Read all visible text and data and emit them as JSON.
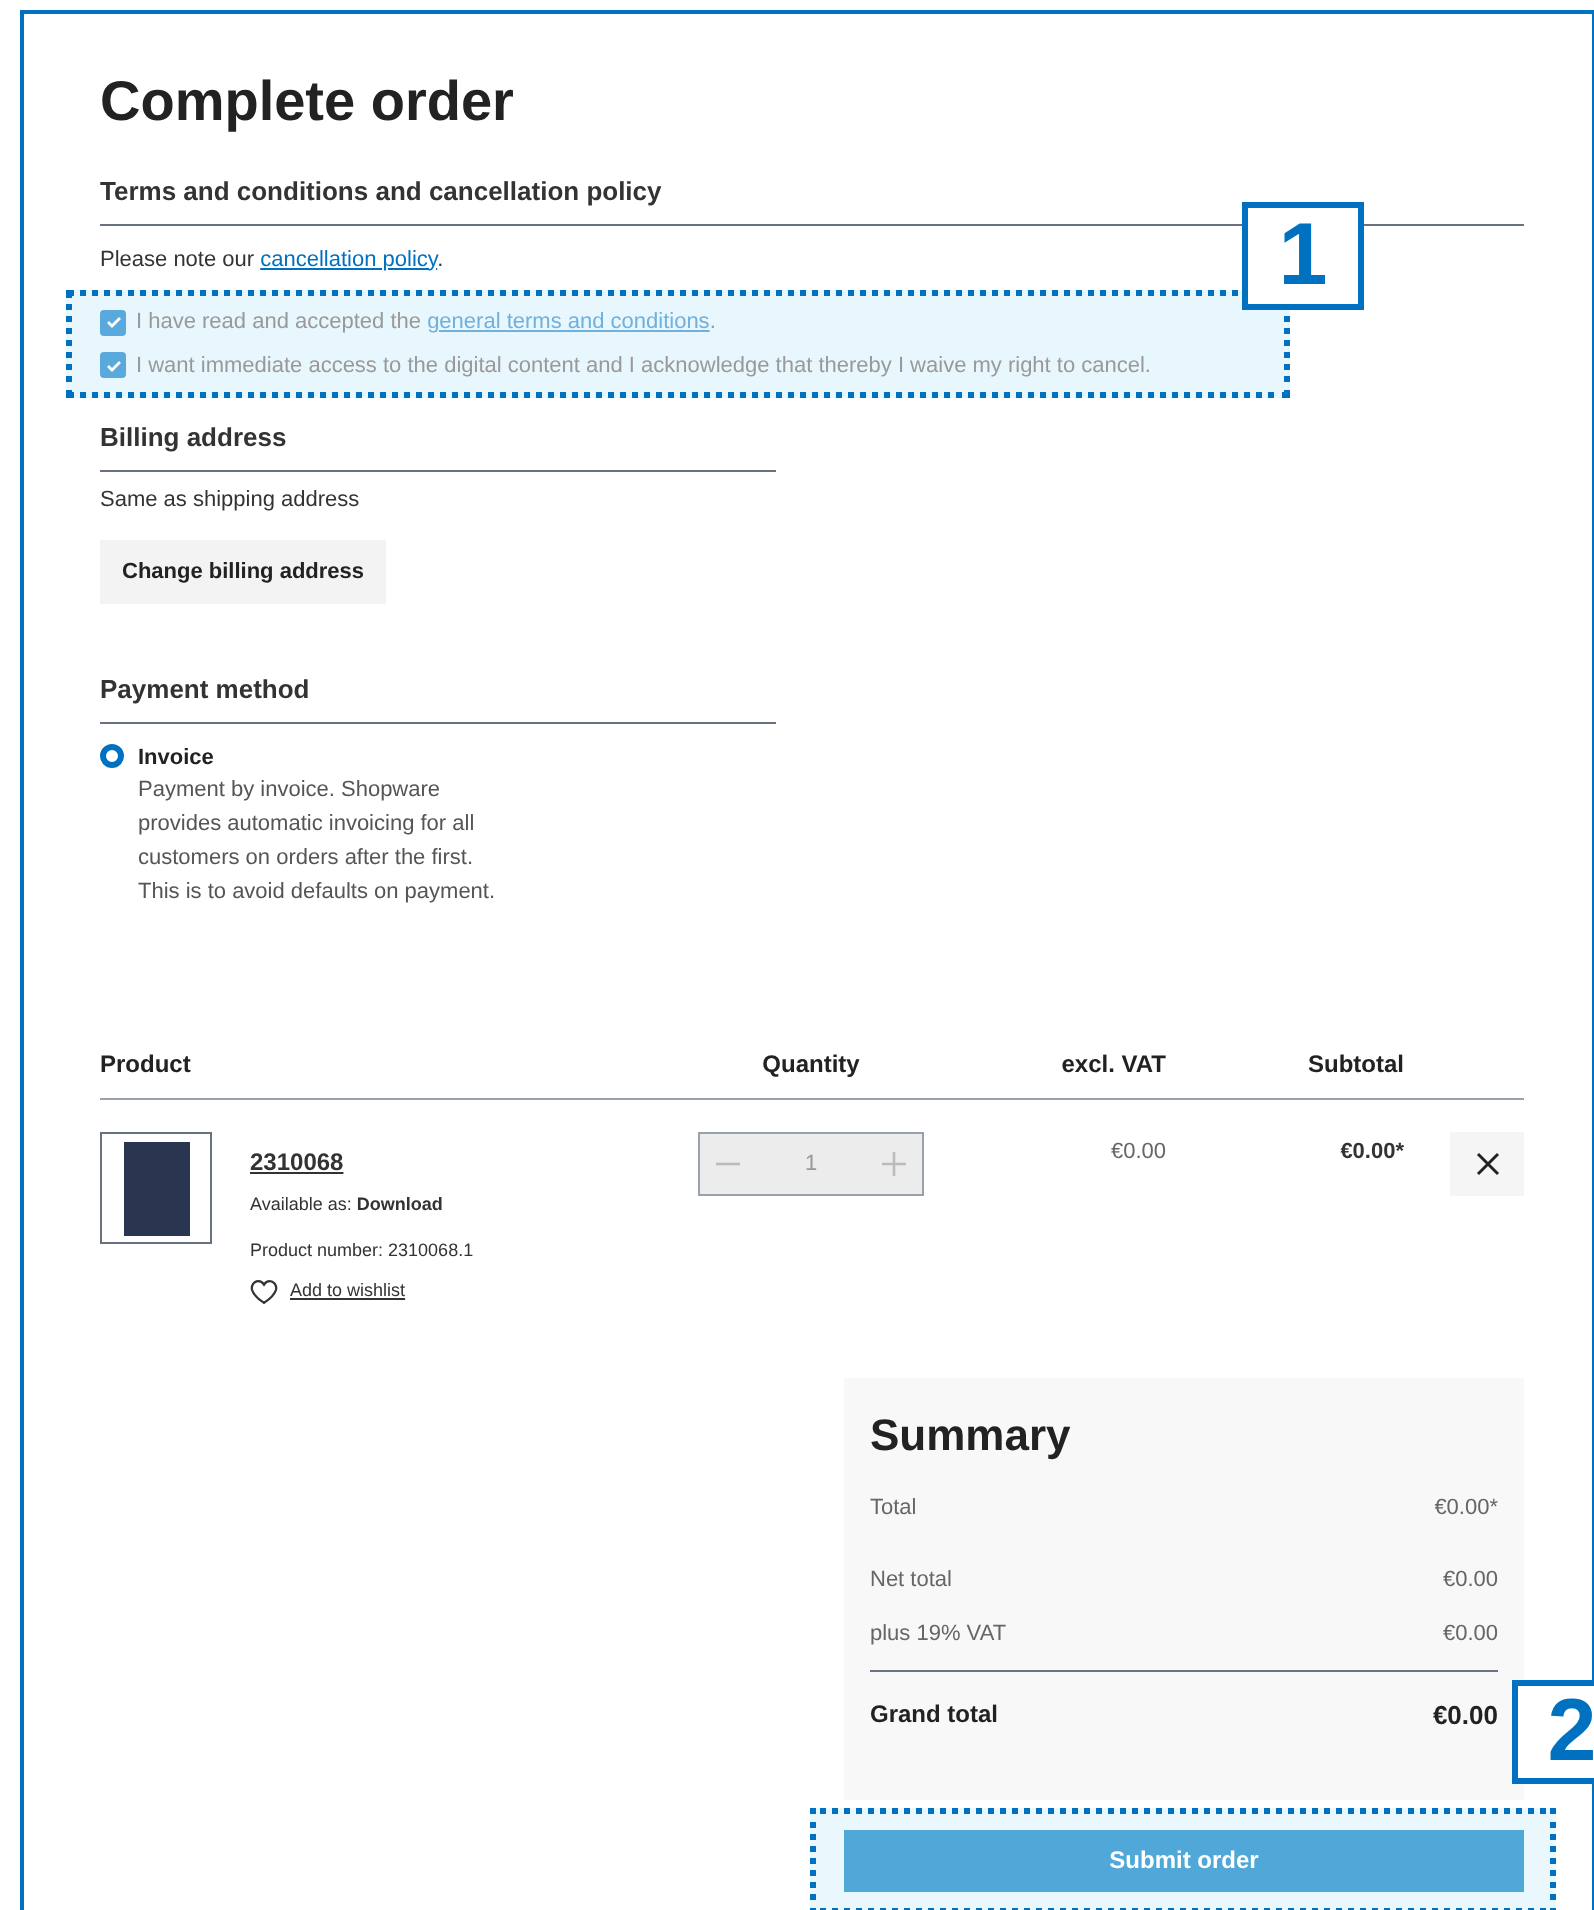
{
  "title": "Complete order",
  "terms": {
    "heading": "Terms and conditions and cancellation policy",
    "note_before": "Please note our ",
    "note_link": "cancellation policy",
    "note_after": ".",
    "checkboxes": [
      {
        "text_before": "I have read and accepted the ",
        "link": "general terms and conditions",
        "text_after": ".",
        "checked": true
      },
      {
        "text_before": "I want immediate access to the digital content and I acknowledge that thereby I waive my right to cancel.",
        "checked": true
      }
    ]
  },
  "billing": {
    "heading": "Billing address",
    "text": "Same as shipping address",
    "button": "Change billing address"
  },
  "payment": {
    "heading": "Payment method",
    "options": [
      {
        "label": "Invoice",
        "description": "Payment by invoice. Shopware provides automatic invoicing for all customers on orders after the first. This is to avoid defaults on payment.",
        "selected": true
      }
    ]
  },
  "table": {
    "columns": [
      "Product",
      "Quantity",
      "excl. VAT",
      "Subtotal"
    ],
    "rows": [
      {
        "name": "2310068",
        "available_label": "Available as: ",
        "available_value": "Download",
        "product_number": "Product number: 2310068.1",
        "wishlist": "Add to wishlist",
        "quantity": "1",
        "excl_vat": "€0.00",
        "subtotal": "€0.00*"
      }
    ]
  },
  "summary": {
    "title": "Summary",
    "rows": [
      {
        "label": "Total",
        "value": "€0.00*",
        "kind": "plain"
      },
      {
        "label": "Net total",
        "value": "€0.00",
        "kind": "plain"
      },
      {
        "label": "plus 19% VAT",
        "value": "€0.00",
        "kind": "plain"
      },
      {
        "label": "Grand total",
        "value": "€0.00",
        "kind": "grand"
      }
    ],
    "button": "Submit order"
  },
  "callouts": [
    {
      "label": "1"
    },
    {
      "label": "2"
    }
  ]
}
